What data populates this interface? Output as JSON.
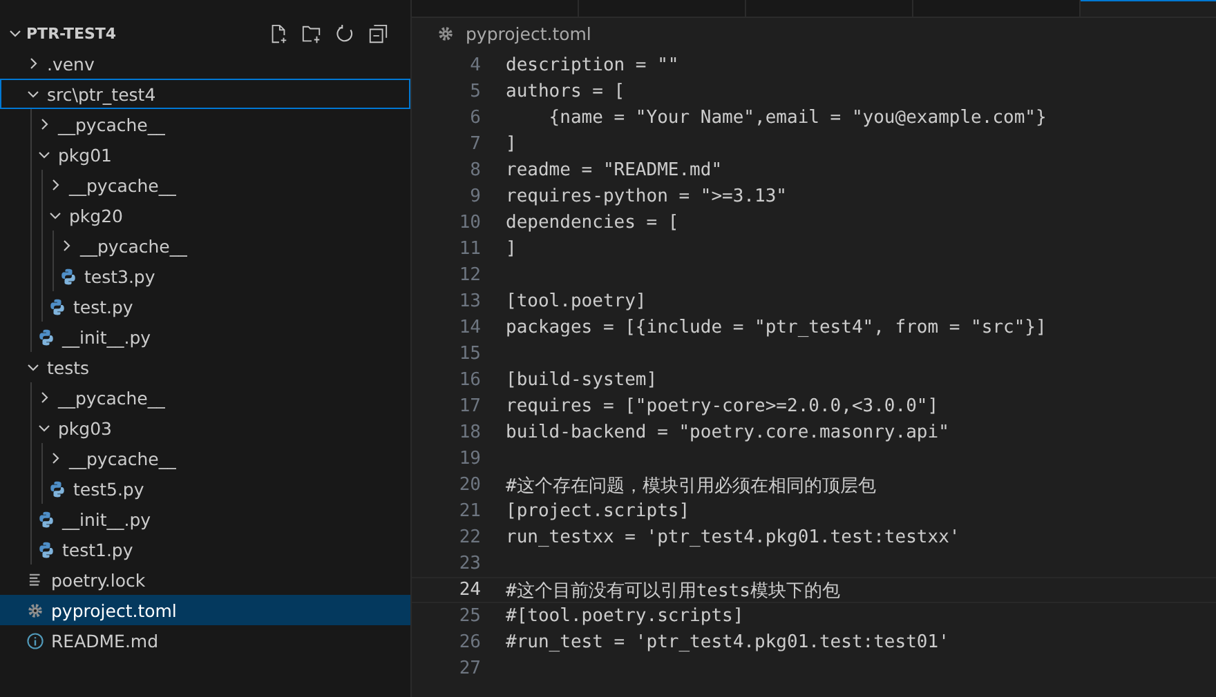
{
  "explorer": {
    "title": "PTR-TEST4",
    "expanded": true,
    "items": [
      {
        "label": ".venv",
        "kind": "folder",
        "expanded": false,
        "selected": false,
        "focused": false
      },
      {
        "label": "src\\ptr_test4",
        "kind": "folder",
        "expanded": true,
        "selected": false,
        "focused": true,
        "children": [
          {
            "label": "__pycache__",
            "kind": "folder",
            "expanded": false,
            "selected": false,
            "focused": false
          },
          {
            "label": "pkg01",
            "kind": "folder",
            "expanded": true,
            "selected": false,
            "focused": false,
            "children": [
              {
                "label": "__pycache__",
                "kind": "folder",
                "expanded": false,
                "selected": false,
                "focused": false
              },
              {
                "label": "pkg20",
                "kind": "folder",
                "expanded": true,
                "selected": false,
                "focused": false,
                "children": [
                  {
                    "label": "__pycache__",
                    "kind": "folder",
                    "expanded": false,
                    "selected": false,
                    "focused": false
                  },
                  {
                    "label": "test3.py",
                    "kind": "python",
                    "selected": false,
                    "focused": false
                  }
                ]
              },
              {
                "label": "test.py",
                "kind": "python",
                "selected": false,
                "focused": false
              }
            ]
          },
          {
            "label": "__init__.py",
            "kind": "python",
            "selected": false,
            "focused": false
          }
        ]
      },
      {
        "label": "tests",
        "kind": "folder",
        "expanded": true,
        "selected": false,
        "focused": false,
        "children": [
          {
            "label": "__pycache__",
            "kind": "folder",
            "expanded": false,
            "selected": false,
            "focused": false
          },
          {
            "label": "pkg03",
            "kind": "folder",
            "expanded": true,
            "selected": false,
            "focused": false,
            "children": [
              {
                "label": "__pycache__",
                "kind": "folder",
                "expanded": false,
                "selected": false,
                "focused": false
              },
              {
                "label": "test5.py",
                "kind": "python",
                "selected": false,
                "focused": false
              }
            ]
          },
          {
            "label": "__init__.py",
            "kind": "python",
            "selected": false,
            "focused": false
          },
          {
            "label": "test1.py",
            "kind": "python",
            "selected": false,
            "focused": false
          }
        ]
      },
      {
        "label": "poetry.lock",
        "kind": "lock",
        "selected": false,
        "focused": false
      },
      {
        "label": "pyproject.toml",
        "kind": "settings",
        "selected": true,
        "focused": false
      },
      {
        "label": "README.md",
        "kind": "info",
        "selected": false,
        "focused": false
      }
    ]
  },
  "tabs": [
    {
      "selected": false
    },
    {
      "selected": false
    },
    {
      "selected": false
    },
    {
      "selected": false
    },
    {
      "selected": true
    }
  ],
  "breadcrumb": {
    "label": "pyproject.toml"
  },
  "editor": {
    "lines": [
      {
        "number": "4",
        "text": "description = \"\"",
        "current": false
      },
      {
        "number": "5",
        "text": "authors = [",
        "current": false
      },
      {
        "number": "6",
        "text": "    {name = \"Your Name\",email = \"you@example.com\"}",
        "current": false
      },
      {
        "number": "7",
        "text": "]",
        "current": false
      },
      {
        "number": "8",
        "text": "readme = \"README.md\"",
        "current": false
      },
      {
        "number": "9",
        "text": "requires-python = \">=3.13\"",
        "current": false
      },
      {
        "number": "10",
        "text": "dependencies = [",
        "current": false
      },
      {
        "number": "11",
        "text": "]",
        "current": false
      },
      {
        "number": "12",
        "current": false
      },
      {
        "number": "13",
        "text": "[tool.poetry]",
        "current": false
      },
      {
        "number": "14",
        "text": "packages = [{include = \"ptr_test4\", from = \"src\"}]",
        "current": false
      },
      {
        "number": "15",
        "current": false
      },
      {
        "number": "16",
        "text": "[build-system]",
        "current": false
      },
      {
        "number": "17",
        "text": "requires = [\"poetry-core>=2.0.0,<3.0.0\"]",
        "current": false
      },
      {
        "number": "18",
        "text": "build-backend = \"poetry.core.masonry.api\"",
        "current": false
      },
      {
        "number": "19",
        "current": false
      },
      {
        "number": "20",
        "text": "#这个存在问题，模块引用必须在相同的顶层包",
        "current": false
      },
      {
        "number": "21",
        "text": "[project.scripts]",
        "current": false
      },
      {
        "number": "22",
        "text": "run_testxx = 'ptr_test4.pkg01.test:testxx'",
        "current": false
      },
      {
        "number": "23",
        "current": false
      },
      {
        "number": "24",
        "text": "#这个目前没有可以引用tests模块下的包",
        "current": true
      },
      {
        "number": "25",
        "text": "#[tool.poetry.scripts]",
        "current": false
      },
      {
        "number": "26",
        "text": "#run_test = 'ptr_test4.pkg01.test:test01'",
        "current": false
      },
      {
        "number": "27",
        "current": false
      }
    ]
  }
}
